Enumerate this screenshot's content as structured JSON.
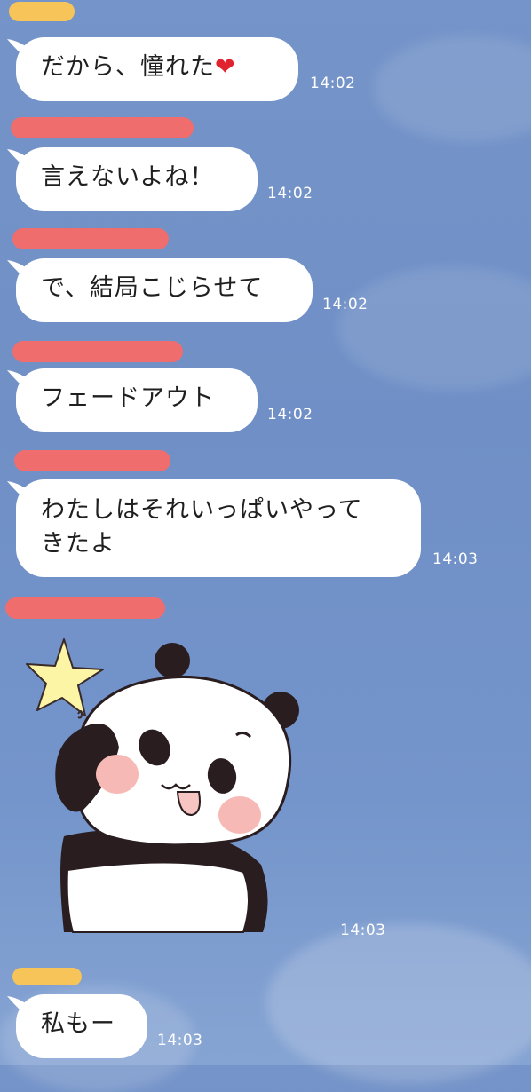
{
  "colors": {
    "background": "#7594c9",
    "bubble": "#ffffff",
    "redaction": "#f06d6d",
    "redaction_yellow": "#f7c45a",
    "heart": "#e0232e"
  },
  "messages": [
    {
      "text": "だから、憧れた",
      "emoji": "❤️",
      "time": "14:02"
    },
    {
      "text": "言えないよね！",
      "time": "14:02"
    },
    {
      "text": "で、結局こじらせて",
      "time": "14:02"
    },
    {
      "text": "フェードアウト",
      "time": "14:02"
    },
    {
      "line1": "わたしはそれいっぱいやって",
      "line2": "きたよ",
      "time": "14:03"
    },
    {
      "sticker": "panda-sticker",
      "time": "14:03"
    },
    {
      "text": "私もー",
      "time": "14:03"
    }
  ]
}
